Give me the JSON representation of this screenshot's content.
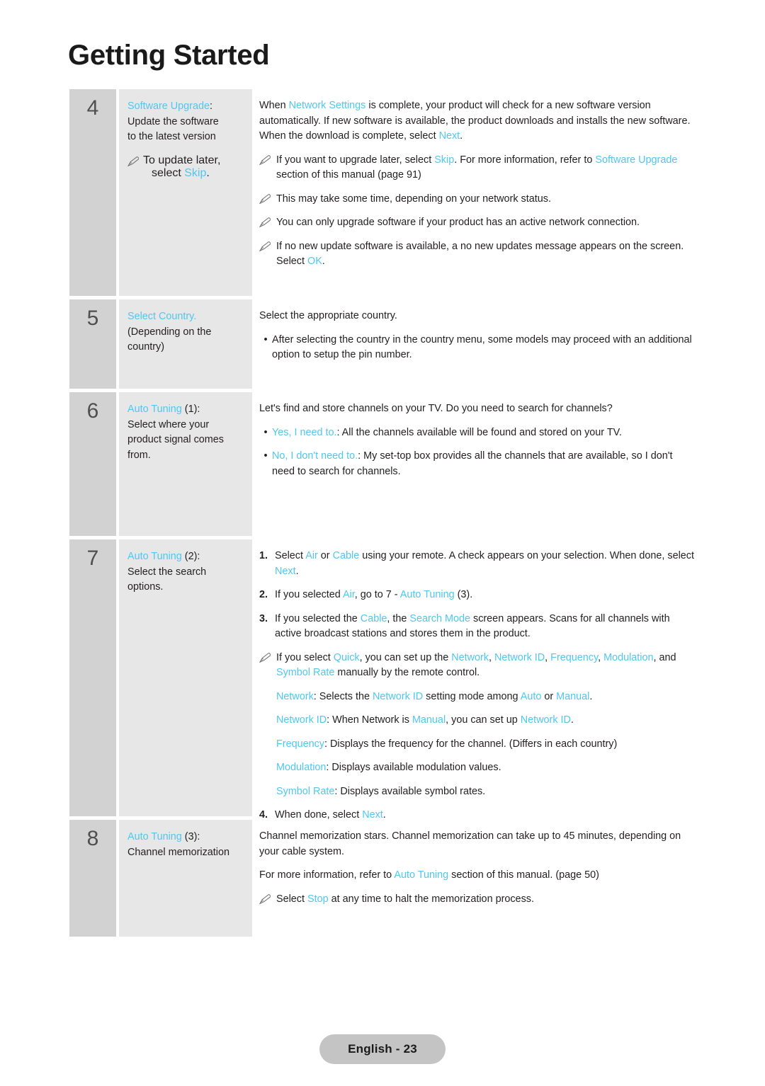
{
  "page": {
    "title": "Getting Started",
    "footer_label": "English - 23",
    "accent_color": "#4fc7ef",
    "num_cell_color": "#d2d2d2",
    "desc_cell_color": "#e7e7e7"
  },
  "steps": [
    {
      "number": "4",
      "desc": {
        "title": "Software Upgrade",
        "title_suffix": ":",
        "line1": "Update the software",
        "line2": "to the latest version",
        "note_pre": "To update later,",
        "note_line2_pre": "select ",
        "note_accent": "Skip",
        "note_line2_post": "."
      },
      "body": {
        "p1_a": "When ",
        "p1_b": "Network Settings",
        "p1_c": " is complete, your product will check for a new software version automatically. If new software is available, the product downloads and installs the new software. When the download is complete, select ",
        "p1_d": "Next",
        "p1_e": ".",
        "n1_a": "If you want to upgrade later, select ",
        "n1_b": "Skip",
        "n1_c": ". For more information, refer to ",
        "n1_d": "Software Upgrade",
        "n1_e": " section of this manual (page 91)",
        "n2_a": "This may take some time, depending on your network status.",
        "n3_a": "You can only upgrade software if your product has an active network connection.",
        "n4_a": "If no new update software is available, a no new updates message appears on the screen. Select ",
        "n4_b": "OK",
        "n4_c": "."
      }
    },
    {
      "number": "5",
      "desc": {
        "title": "Select Country.",
        "title_suffix": "",
        "line1": "(Depending on the",
        "line2": "country)"
      },
      "body": {
        "p1_a": "Select the appropriate country.",
        "b1_a": "After selecting the country in the country menu, some models may proceed with an additional option to setup the pin number."
      }
    },
    {
      "number": "6",
      "desc": {
        "title": "Auto Tuning",
        "title_suffix": " (1):",
        "line1": "Select where your",
        "line2": "product signal comes",
        "line3": "from."
      },
      "body": {
        "p1_a": "Let's find and store channels on your TV. Do you need to search for channels?",
        "b1_accent": "Yes, I need to.",
        "b1_rest": ": All the channels available will be found and stored on your TV.",
        "b2_accent": "No, I don't need to.",
        "b2_rest": ": My set-top box provides all the channels that are available, so I don't need to search for channels."
      }
    },
    {
      "number": "7",
      "desc": {
        "title": "Auto Tuning",
        "title_suffix": " (2):",
        "line1": "Select the search",
        "line2": "options."
      },
      "body": {
        "i1_num": "1.",
        "i1_a": "Select ",
        "i1_b": "Air",
        "i1_c": " or ",
        "i1_d": "Cable",
        "i1_e": " using your remote. A check appears on your selection. When done, select ",
        "i1_f": "Next",
        "i1_g": ".",
        "i2_num": "2.",
        "i2_a": "If you selected ",
        "i2_b": "Air",
        "i2_c": ", go to 7 - ",
        "i2_d": "Auto Tuning",
        "i2_e": " (3).",
        "i3_num": "3.",
        "i3_a": "If you selected the ",
        "i3_b": "Cable",
        "i3_c": ", the ",
        "i3_d": "Search Mode",
        "i3_e": " screen appears. Scans for all channels with active broadcast stations and stores them in the product.",
        "note_a": "If you select ",
        "note_b": "Quick",
        "note_c": ", you can set up the ",
        "note_d": "Network",
        "note_e": ", ",
        "note_f": "Network ID",
        "note_g": ", ",
        "note_h": "Frequency",
        "note_i": ", ",
        "note_j": "Modulation",
        "note_k": ", and ",
        "note_l": "Symbol Rate",
        "note_m": " manually by the remote control.",
        "d1_term": "Network",
        "d1_a": ": Selects the ",
        "d1_b": "Network ID",
        "d1_c": " setting mode among ",
        "d1_d": "Auto",
        "d1_e": " or ",
        "d1_f": "Manual",
        "d1_g": ".",
        "d2_term": "Network ID",
        "d2_a": ": When Network is ",
        "d2_b": "Manual",
        "d2_c": ", you can set up ",
        "d2_d": "Network ID",
        "d2_e": ".",
        "d3_term": "Frequency",
        "d3_a": ": Displays the frequency for the channel. (Differs in each country)",
        "d4_term": "Modulation",
        "d4_a": ": Displays available modulation values.",
        "d5_term": "Symbol Rate",
        "d5_a": ": Displays available symbol rates.",
        "i4_num": "4.",
        "i4_a": "When done, select ",
        "i4_b": "Next",
        "i4_c": "."
      }
    },
    {
      "number": "8",
      "desc": {
        "title": "Auto Tuning",
        "title_suffix": " (3):",
        "line1": "Channel memorization"
      },
      "body": {
        "p1_a": "Channel memorization stars. Channel memorization can take up to 45 minutes, depending on your cable system.",
        "p2_a": "For more information, refer to ",
        "p2_b": "Auto Tuning",
        "p2_c": " section of this manual. (page 50)",
        "n1_a": "Select ",
        "n1_b": "Stop",
        "n1_c": " at any time to halt the memorization process."
      }
    }
  ],
  "icons": {
    "pencil": "pencil-note-icon",
    "bullet": "•"
  }
}
